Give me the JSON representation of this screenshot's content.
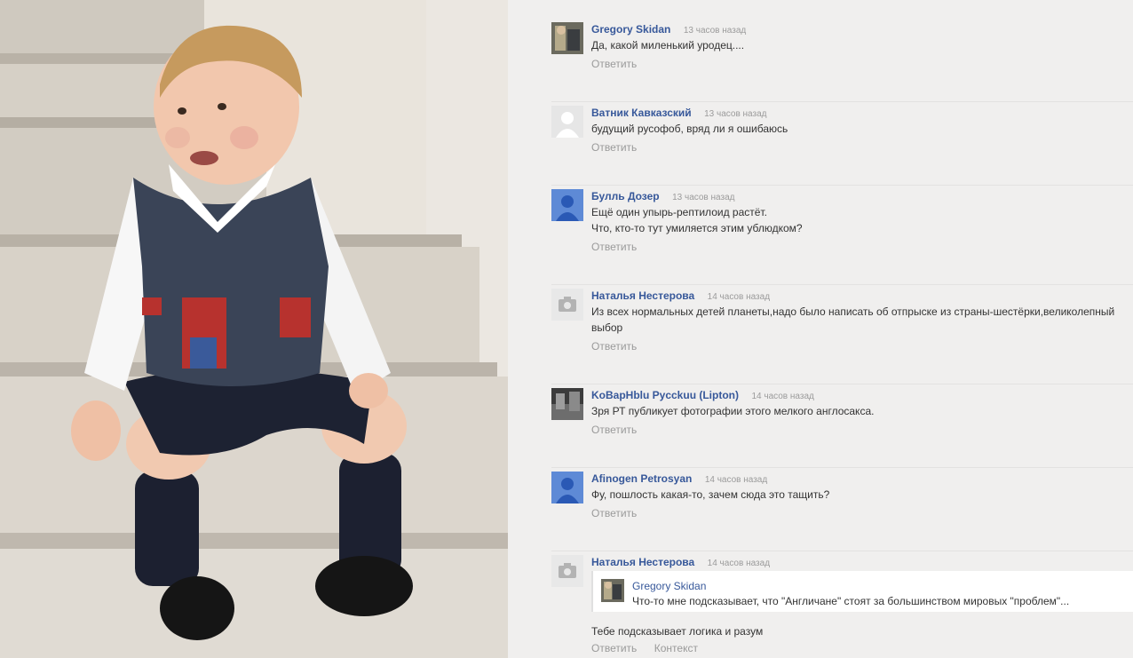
{
  "photo": {
    "description_icon": "photo-of-child"
  },
  "comments": [
    {
      "author": "Gregory Skidan",
      "time": "13 часов назад",
      "text_lines": [
        "Да, какой миленький уродец...."
      ],
      "avatar": "photo-avatar",
      "reply_label": "Ответить"
    },
    {
      "author": "Ватник Кавказский",
      "time": "13 часов назад",
      "text_lines": [
        "будущий русофоб, вряд ли я ошибаюсь"
      ],
      "avatar": "default-person-avatar-grey",
      "reply_label": "Ответить"
    },
    {
      "author": "Булль Дозер",
      "time": "13 часов назад",
      "text_lines": [
        "Ещё один упырь-рептилоид растёт.",
        "Что, кто-то тут умиляется этим ублюдком?"
      ],
      "avatar": "default-person-avatar-blue",
      "reply_label": "Ответить"
    },
    {
      "author": "Наталья Нестерова",
      "time": "14 часов назад",
      "text_lines": [
        "Из всех нормальных детей планеты,надо было написать об отпрыске из страны-шестёрки,великолепный",
        "выбор"
      ],
      "avatar": "camera-avatar",
      "reply_label": "Ответить"
    },
    {
      "author": "KoBapHblu Pycckuu (Lipton)",
      "time": "14 часов назад",
      "text_lines": [
        "Зря РТ публикует фотографии этого мелкого англосакса."
      ],
      "avatar": "photo-avatar-dark",
      "reply_label": "Ответить"
    },
    {
      "author": "Afinogen Petrosyan",
      "time": "14 часов назад",
      "text_lines": [
        "Фу, пошлость какая-то, зачем сюда это тащить?"
      ],
      "avatar": "default-person-avatar-blue",
      "reply_label": "Ответить"
    },
    {
      "author": "Наталья Нестерова",
      "time": "14 часов назад",
      "quote": {
        "author": "Gregory Skidan",
        "text": "Что-то мне подсказывает, что \"Англичане\" стоят за большинством мировых \"проблем\"..."
      },
      "text_lines": [
        "Тебе подсказывает логика и разум"
      ],
      "avatar": "camera-avatar",
      "reply_label": "Ответить",
      "context_label": "Контекст"
    }
  ],
  "colors": {
    "author": "#37589a",
    "time": "#9b9b9b",
    "action": "#9a9a9a",
    "text": "#333333",
    "panel_bg": "#f0efee"
  }
}
